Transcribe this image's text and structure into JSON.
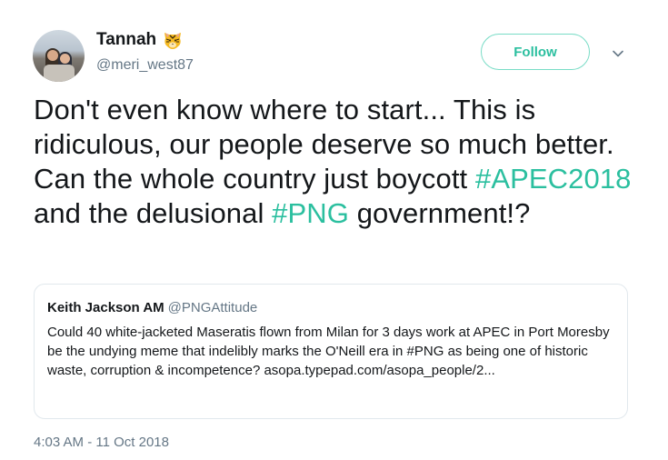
{
  "author": {
    "display_name": "Tannah",
    "handle": "@meri_west87",
    "emoji_icon": "tiger-face-icon"
  },
  "follow_label": "Follow",
  "tweet": {
    "part1": "Don't even know where to start... This is ridiculous, our people deserve so much better. Can the whole country just boycott ",
    "hashtag1": "#APEC2018",
    "part2": " and the delusional ",
    "hashtag2": "#PNG",
    "part3": " government!?"
  },
  "quote": {
    "name": "Keith Jackson AM",
    "handle": "@PNGAttitude",
    "text": "Could 40 white-jacketed Maseratis flown from Milan for 3 days work at APEC in Port Moresby be the undying meme that indelibly marks the O'Neill era in #PNG as being one of historic waste, corruption & incompetence?",
    "link": "asopa.typepad.com/asopa_people/2..."
  },
  "timestamp": "4:03 AM - 11 Oct 2018",
  "colors": {
    "accent": "#2bbf9f",
    "secondary_text": "#657786",
    "border": "#e1e8ed"
  }
}
